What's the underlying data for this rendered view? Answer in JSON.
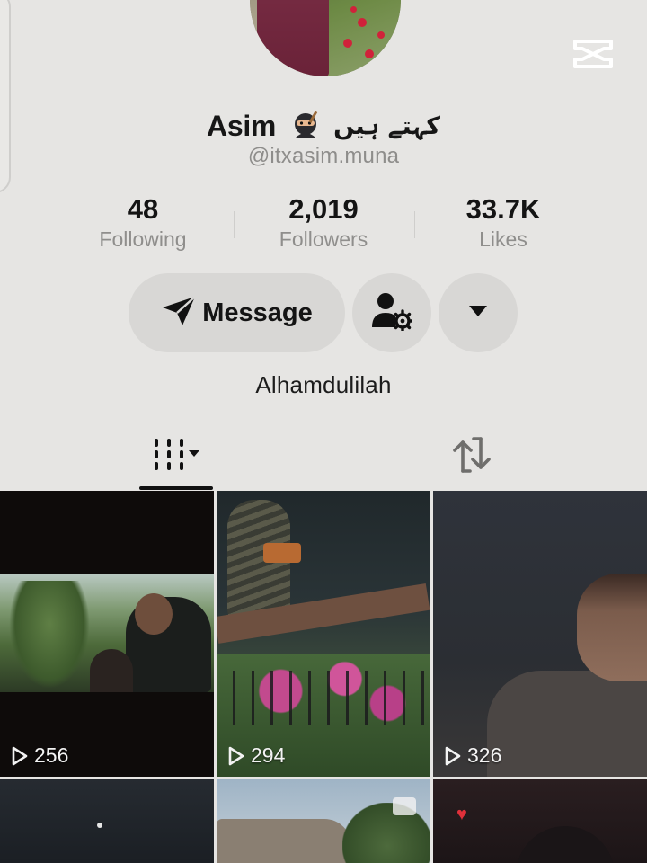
{
  "profile": {
    "name": "Asim",
    "name_emoji": "ninja",
    "name_urdu": "کہتے ہیں",
    "handle": "@itxasim.muna",
    "bio": "Alhamdulilah"
  },
  "stats": [
    {
      "value": "48",
      "label": "Following"
    },
    {
      "value": "2,019",
      "label": "Followers"
    },
    {
      "value": "33.7K",
      "label": "Likes"
    }
  ],
  "actions": {
    "message_label": "Message",
    "message_icon": "paper-plane-icon",
    "friend_icon": "user-settings-icon",
    "more_icon": "caret-down-icon"
  },
  "tabs": [
    {
      "name": "videos",
      "icon": "grid-columns-icon",
      "has_dropdown": true,
      "active": true
    },
    {
      "name": "reposts",
      "icon": "repost-icon",
      "active": false
    }
  ],
  "videos": [
    {
      "views": "256"
    },
    {
      "views": "294"
    },
    {
      "views": "326"
    },
    {
      "views": ""
    },
    {
      "views": ""
    },
    {
      "views": ""
    }
  ],
  "watermark": "capcut-logo",
  "colors": {
    "background": "#e6e5e3",
    "button_bg": "#d8d7d5",
    "primary_text": "#161616",
    "secondary_text": "#8f8e8c"
  }
}
